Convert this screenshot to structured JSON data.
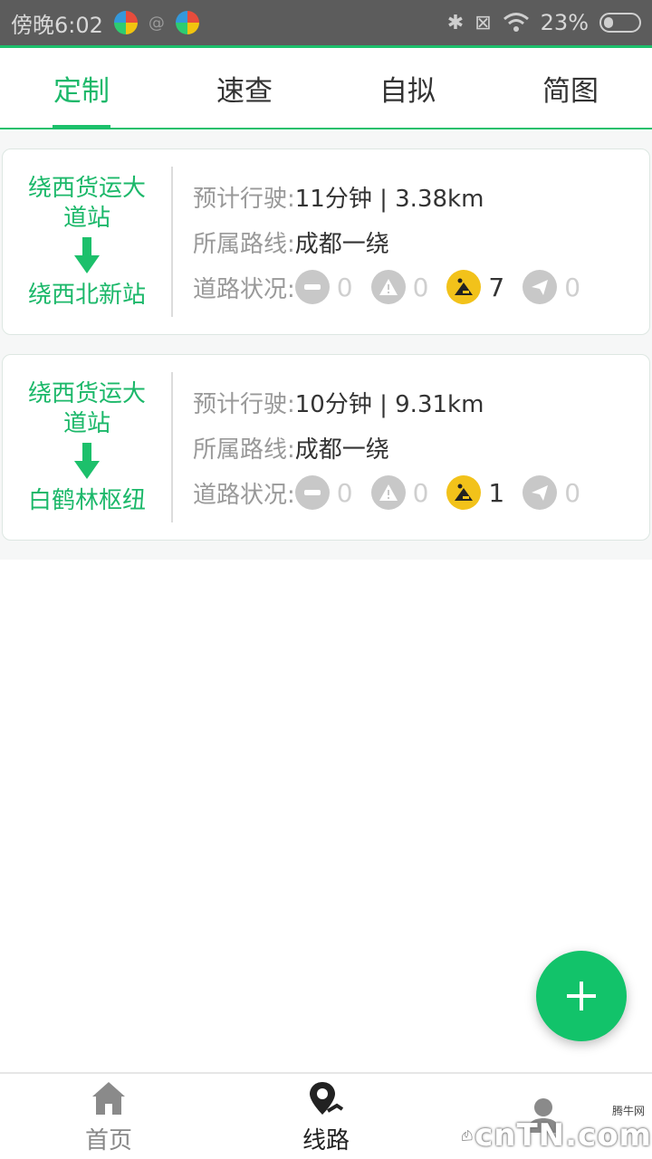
{
  "status_bar": {
    "time": "傍晚6:02",
    "battery_percent": "23%"
  },
  "tabs": [
    {
      "label": "定制",
      "active": true
    },
    {
      "label": "速查",
      "active": false
    },
    {
      "label": "自拟",
      "active": false
    },
    {
      "label": "简图",
      "active": false
    }
  ],
  "routes": [
    {
      "from": "绕西货运大道站",
      "to": "绕西北新站",
      "travel_label": "预计行驶:",
      "travel_value": "11分钟 | 3.38km",
      "route_label": "所属路线:",
      "route_value": "成都一绕",
      "condition_label": "道路状况:",
      "conditions": {
        "closure": "0",
        "warning": "0",
        "construction": "7",
        "report": "0"
      }
    },
    {
      "from": "绕西货运大道站",
      "to": "白鹤林枢纽",
      "travel_label": "预计行驶:",
      "travel_value": "10分钟 | 9.31km",
      "route_label": "所属路线:",
      "route_value": "成都一绕",
      "condition_label": "道路状况:",
      "conditions": {
        "closure": "0",
        "warning": "0",
        "construction": "1",
        "report": "0"
      }
    }
  ],
  "bottom_nav": [
    {
      "label": "首页",
      "icon": "home-icon",
      "active": false
    },
    {
      "label": "线路",
      "icon": "route-pin-icon",
      "active": true
    },
    {
      "label": "",
      "icon": "user-icon",
      "active": false
    }
  ],
  "watermark": {
    "text": "cnTN.com",
    "small": "腾牛网"
  },
  "colors": {
    "accent": "#1cc06b",
    "construction": "#f2c21a"
  }
}
